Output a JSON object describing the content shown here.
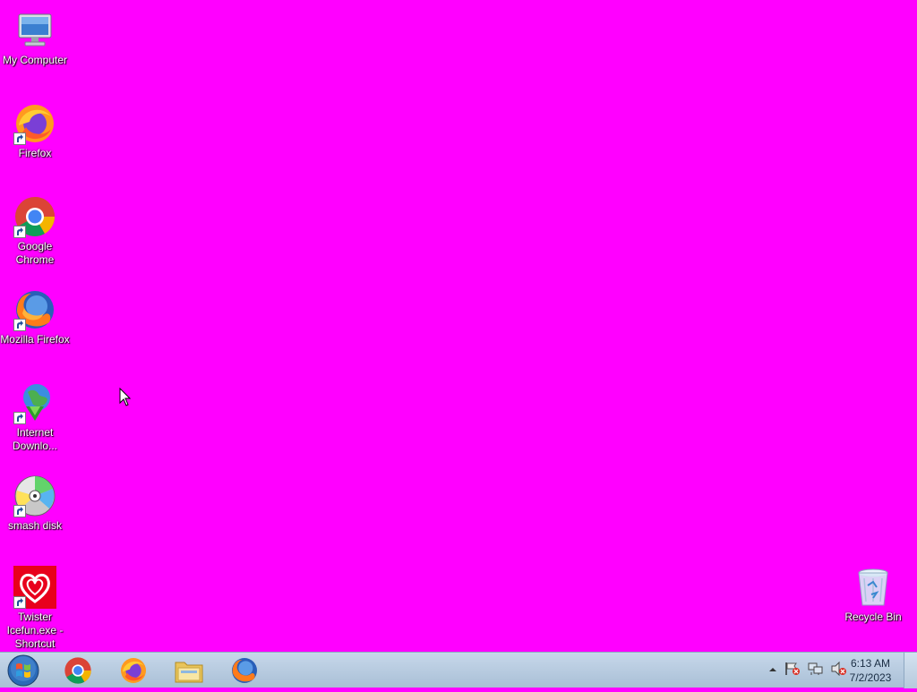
{
  "desktop": {
    "background": "#ff00ff",
    "icons": [
      {
        "label": "My Computer",
        "icon": "computer-icon"
      },
      {
        "label": "Firefox",
        "icon": "firefox-icon"
      },
      {
        "label": "Google Chrome",
        "icon": "chrome-icon"
      },
      {
        "label": "Mozilla Firefox",
        "icon": "firefox-icon"
      },
      {
        "label": "Internet Downlo...",
        "icon": "internet-download-manager-icon"
      },
      {
        "label": "smash disk",
        "icon": "disc-icon"
      },
      {
        "label": "Twister Icefun.exe - Shortcut",
        "icon": "algida-icon"
      },
      {
        "label": "Recycle Bin",
        "icon": "recycle-bin-icon"
      }
    ]
  },
  "taskbar": {
    "start_icon": "windows-logo-icon",
    "pinned": [
      "chrome-icon",
      "firefox-icon",
      "file-explorer-icon",
      "firefox-icon"
    ],
    "tray_icons": [
      "show-hidden-icons-icon",
      "action-center-flag-icon",
      "network-icon",
      "volume-muted-icon"
    ],
    "clock": {
      "time": "6:13 AM",
      "date": "7/2/2023"
    }
  }
}
